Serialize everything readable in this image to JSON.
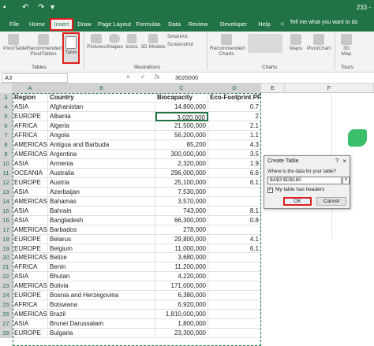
{
  "titlebar": {
    "right_text": "233 -"
  },
  "tabs": [
    "File",
    "Home",
    "Insert",
    "Draw",
    "Page Layout",
    "Formulas",
    "Data",
    "Review",
    "Developer",
    "Help"
  ],
  "tell_me": "Tell me what you want to do",
  "ribbon": {
    "buttons": {
      "pivottable": "PivotTable",
      "recommended_pivottables": "Recommended PivotTables",
      "table": "Table",
      "pictures": "Pictures",
      "shapes": "Shapes",
      "icons": "Icons",
      "models3d": "3D Models",
      "smartart": "SmartArt",
      "screenshot": "Screenshot",
      "recommended_charts": "Recommended Charts",
      "maps": "Maps",
      "pivotchart": "PivotChart",
      "map3d": "3D Map"
    },
    "groups": {
      "tables": "Tables",
      "illustrations": "Illustrations",
      "charts": "Charts",
      "tours": "Tours"
    }
  },
  "formula_bar": {
    "name_box": "A3",
    "cancel": "×",
    "enter": "✓",
    "fx": "fx",
    "value": "3020000"
  },
  "columns": [
    "A",
    "B",
    "C",
    "D",
    "E",
    "F"
  ],
  "sheet": {
    "header": {
      "row": "3",
      "a": "Region",
      "b": "Country",
      "c": "Biocapacity",
      "d": "Eco-Footprint PP"
    },
    "rows": [
      {
        "row": "4",
        "a": "ASIA",
        "b": "Afghanistan",
        "c": "14,800,000",
        "d": "0.7"
      },
      {
        "row": "5",
        "a": "EUROPE",
        "b": "Albania",
        "c": "3,020,000",
        "d": "2"
      },
      {
        "row": "6",
        "a": "AFRICA",
        "b": "Algeria",
        "c": "21,500,000",
        "d": "2.1"
      },
      {
        "row": "7",
        "a": "AFRICA",
        "b": "Angola",
        "c": "56,200,000",
        "d": "1.1"
      },
      {
        "row": "8",
        "a": "AMERICAS",
        "b": "Antigua and Barbuda",
        "c": "85,200",
        "d": "4.3"
      },
      {
        "row": "9",
        "a": "AMERICAS",
        "b": "Argentina",
        "c": "300,000,000",
        "d": "3.5"
      },
      {
        "row": "10",
        "a": "ASIA",
        "b": "Armenia",
        "c": "2,320,000",
        "d": "1.9"
      },
      {
        "row": "11",
        "a": "OCEANIA",
        "b": "Australia",
        "c": "296,000,000",
        "d": "6.6"
      },
      {
        "row": "12",
        "a": "EUROPE",
        "b": "Austria",
        "c": "25,100,000",
        "d": "6.1"
      },
      {
        "row": "13",
        "a": "ASIA",
        "b": "Azerbaijan",
        "c": "7,530,000",
        "d": ""
      },
      {
        "row": "14",
        "a": "AMERICAS",
        "b": "Bahamas",
        "c": "3,570,000",
        "d": ""
      },
      {
        "row": "15",
        "a": "ASIA",
        "b": "Bahrain",
        "c": "743,000",
        "d": "8.1"
      },
      {
        "row": "16",
        "a": "ASIA",
        "b": "Bangladesh",
        "c": "66,300,000",
        "d": "0.8"
      },
      {
        "row": "17",
        "a": "AMERICAS",
        "b": "Barbados",
        "c": "278,000",
        "d": ""
      },
      {
        "row": "18",
        "a": "EUROPE",
        "b": "Belarus",
        "c": "29,800,000",
        "d": "4.1"
      },
      {
        "row": "19",
        "a": "EUROPE",
        "b": "Belgium",
        "c": "11,000,000",
        "d": "6.1"
      },
      {
        "row": "20",
        "a": "AMERICAS",
        "b": "Belize",
        "c": "3,680,000",
        "d": ""
      },
      {
        "row": "21",
        "a": "AFRICA",
        "b": "Benin",
        "c": "11,200,000",
        "d": ""
      },
      {
        "row": "22",
        "a": "ASIA",
        "b": "Bhutan",
        "c": "4,220,000",
        "d": ""
      },
      {
        "row": "23",
        "a": "AMERICAS",
        "b": "Bolivia",
        "c": "171,000,000",
        "d": ""
      },
      {
        "row": "24",
        "a": "EUROPE",
        "b": "Bosnia and Herzegovina",
        "c": "6,380,000",
        "d": ""
      },
      {
        "row": "25",
        "a": "AFRICA",
        "b": "Botswana",
        "c": "6,920,000",
        "d": ""
      },
      {
        "row": "26",
        "a": "AMERICAS",
        "b": "Brazil",
        "c": "1,810,000,000",
        "d": ""
      },
      {
        "row": "27",
        "a": "ASIA",
        "b": "Brunei Darussalam",
        "c": "1,800,000",
        "d": ""
      },
      {
        "row": "28",
        "a": "EUROPE",
        "b": "Bulgaria",
        "c": "23,300,000",
        "d": ""
      }
    ]
  },
  "dialog": {
    "title": "Create Table",
    "help": "?",
    "close": "×",
    "prompt": "Where is the data for your table?",
    "range": "$A$3:$D$180",
    "has_headers_label": "My table has headers",
    "has_headers_checked": "✓",
    "ok": "OK",
    "cancel": "Cancel"
  },
  "colors": {
    "excel_green": "#217346",
    "highlight_red": "#e01f1f"
  }
}
